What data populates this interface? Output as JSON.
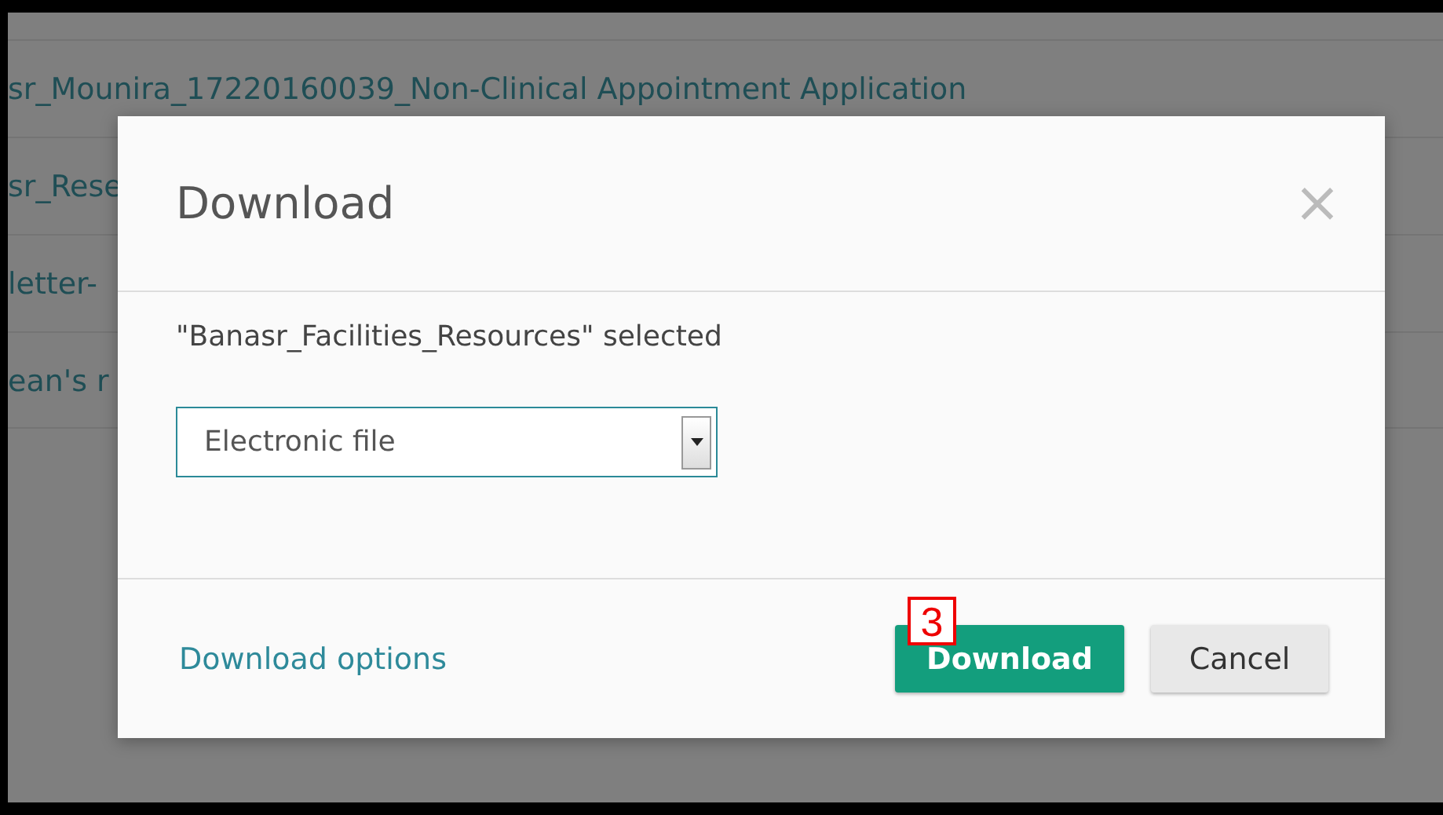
{
  "background_list": {
    "rows": [
      {
        "name": "sr_Mounira_17220160039_Non-Clinical Appointment Application"
      },
      {
        "name": "sr_Rese"
      },
      {
        "name": "letter-"
      },
      {
        "name": "ean's r"
      }
    ]
  },
  "dialog": {
    "title": "Download",
    "close": "×",
    "message": "\"Banasr_Facilities_Resources\" selected",
    "format_select": {
      "value": "Electronic file"
    },
    "options_link": "Download options",
    "buttons": [
      {
        "label": "Download",
        "kind": "primary"
      },
      {
        "label": "Cancel",
        "kind": "secondary"
      }
    ]
  },
  "annotation": {
    "label": "3"
  }
}
